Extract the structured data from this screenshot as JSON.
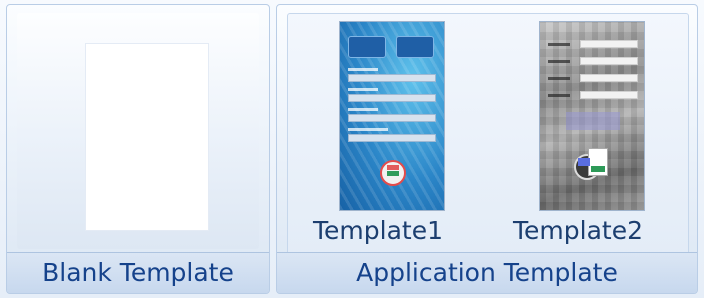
{
  "blank_group": {
    "label": "Blank Template"
  },
  "application_group": {
    "label": "Application Template",
    "templates": [
      {
        "label": "Template1"
      },
      {
        "label": "Template2"
      }
    ]
  },
  "colors": {
    "group_label_text": "#15428b",
    "template_label_text": "#1c3e6f",
    "ribbon_border": "#b9cde6",
    "template1_theme": "#2b86c8",
    "template2_theme": "#8f8f8f"
  },
  "icons": {
    "template1_app_icon": "app-icon",
    "template2_app_icon": "app-icon"
  }
}
